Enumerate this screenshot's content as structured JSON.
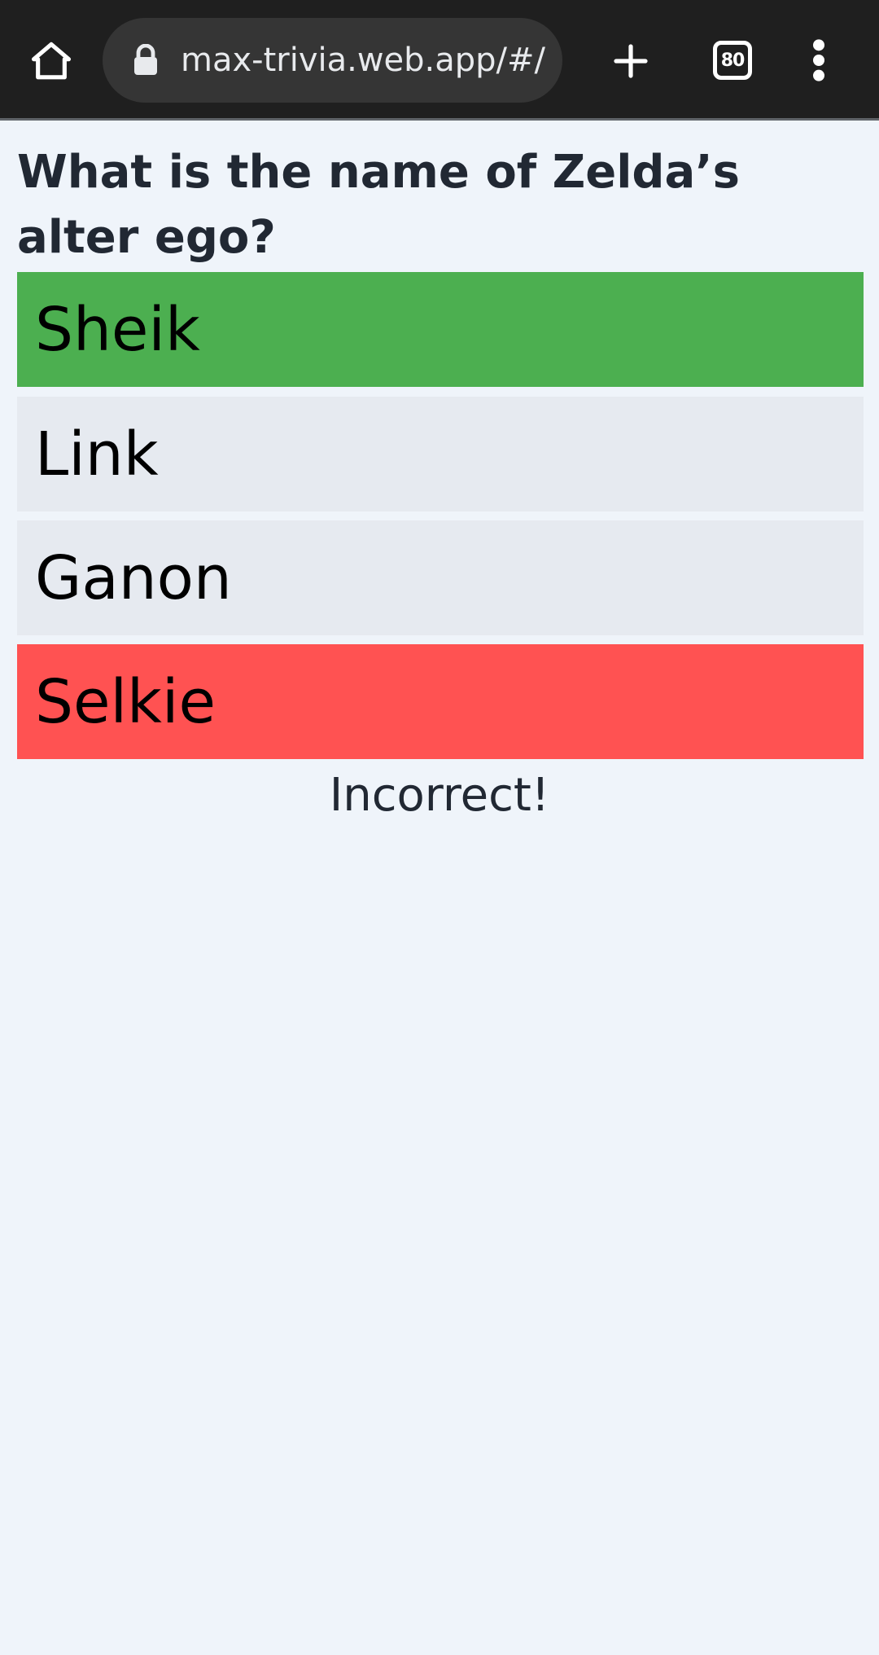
{
  "browser": {
    "url": "max-trivia.web.app/#/",
    "tab_count": "80",
    "icons": {
      "home": "home-icon",
      "lock": "lock-icon",
      "new_tab": "plus-icon",
      "tabs": "tab-switcher-icon",
      "menu": "more-vert-icon"
    }
  },
  "quiz": {
    "question": "What is the name of Zelda’s alter ego?",
    "answers": [
      {
        "label": "Sheik",
        "state": "correct",
        "color": "#4caf50"
      },
      {
        "label": "Link",
        "state": "neutral",
        "color": "#e6eaf0"
      },
      {
        "label": "Ganon",
        "state": "neutral",
        "color": "#e6eaf0"
      },
      {
        "label": "Selkie",
        "state": "incorrect",
        "color": "#ff5252"
      }
    ],
    "result": "Incorrect!"
  },
  "colors": {
    "page_background": "#eff4fa",
    "toolbar_background": "#1f1f1f",
    "url_box_background": "#353535",
    "text": "#212833"
  }
}
